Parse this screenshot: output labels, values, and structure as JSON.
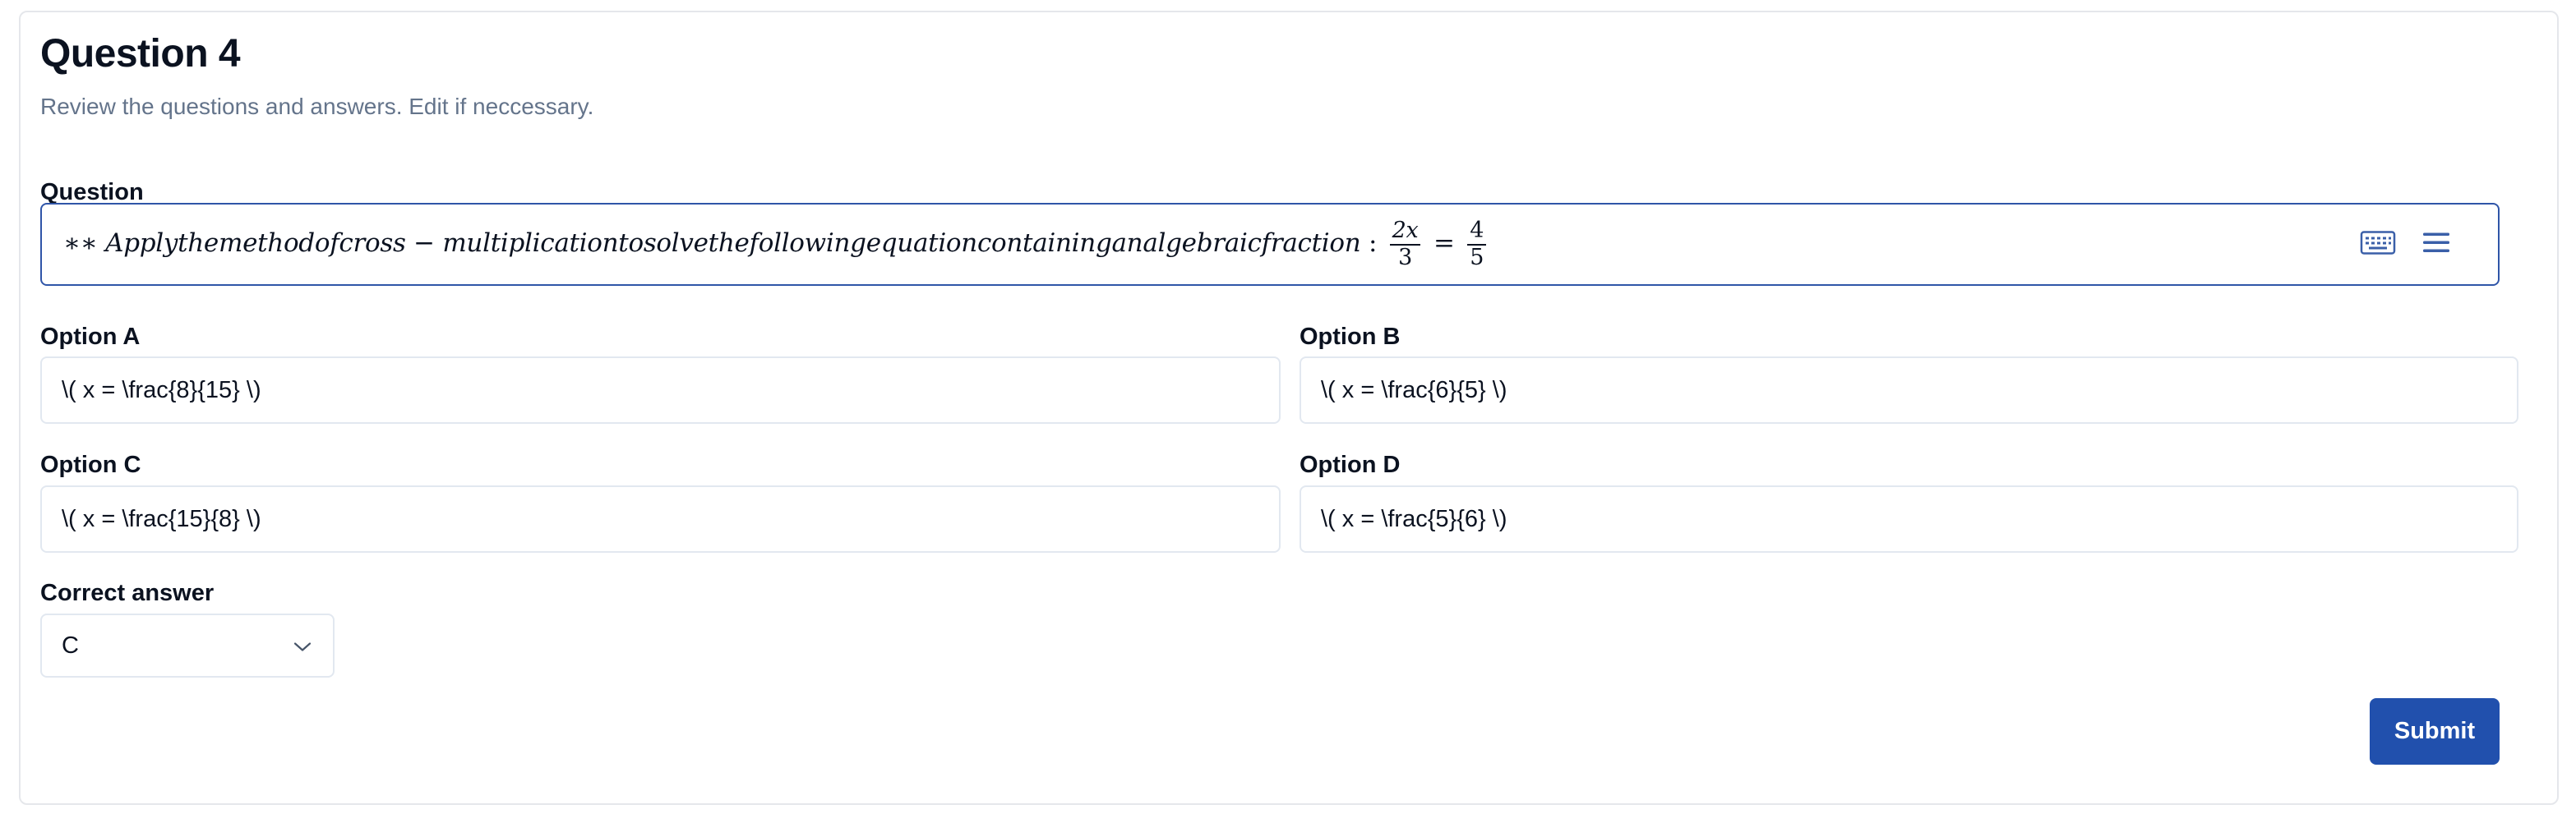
{
  "header": {
    "title": "Question 4",
    "subtitle": "Review the questions and answers. Edit if neccessary."
  },
  "question": {
    "label": "Question",
    "prefix": "∗∗",
    "text": "Applythemethodofcross − multiplicationtosolvethefollowingequationcontaininganalgebraicfraction",
    "colon": ":",
    "frac_left_num": "2x",
    "frac_left_den": "3",
    "equals": "=",
    "frac_right_num": "4",
    "frac_right_den": "5",
    "icons": [
      "keyboard-icon",
      "menu-icon"
    ]
  },
  "options": {
    "a": {
      "label": "Option A",
      "value": "\\( x = \\frac{8}{15} \\)"
    },
    "b": {
      "label": "Option B",
      "value": "\\( x = \\frac{6}{5} \\)"
    },
    "c": {
      "label": "Option C",
      "value": "\\( x = \\frac{15}{8} \\)"
    },
    "d": {
      "label": "Option D",
      "value": "\\( x = \\frac{5}{6} \\)"
    }
  },
  "correct_answer": {
    "label": "Correct answer",
    "value": "C",
    "icon": "chevron-down-icon"
  },
  "actions": {
    "submit_label": "Submit"
  },
  "colors": {
    "accent": "#2150ad",
    "focus_border": "#2f55a8",
    "muted_text": "#64748b",
    "border": "#e2e8f0"
  }
}
